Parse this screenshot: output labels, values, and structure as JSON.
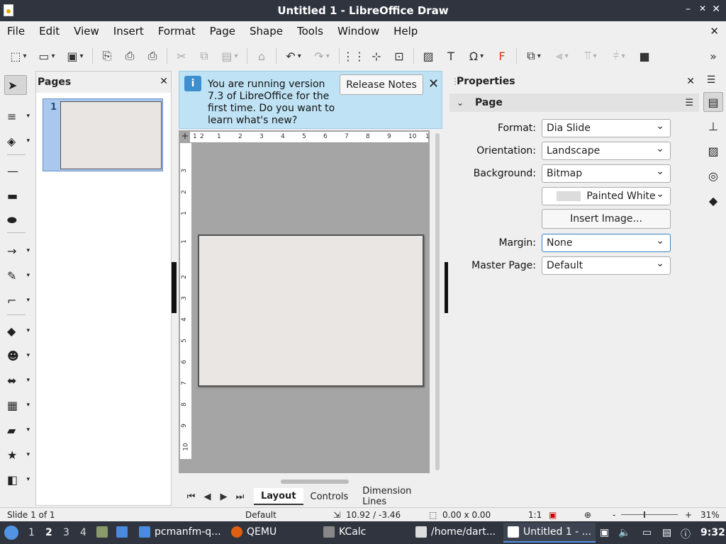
{
  "window": {
    "title": "Untitled 1 - LibreOffice Draw",
    "min": "–",
    "restore": "✕",
    "close": "✕"
  },
  "menu": [
    "File",
    "Edit",
    "View",
    "Insert",
    "Format",
    "Page",
    "Shape",
    "Tools",
    "Window",
    "Help"
  ],
  "menu_close": "✕",
  "pages_panel": {
    "title": "Pages",
    "close": "✕",
    "page_number": "1"
  },
  "infobar": {
    "message": "You are running version 7.3 of LibreOffice for the first time. Do you want to learn what's new?",
    "button": "Release Notes",
    "close": "✕",
    "icon_text": "i"
  },
  "rulers": {
    "h_ticks": [
      "1",
      "2",
      "1",
      "2",
      "3",
      "4",
      "5",
      "6",
      "7",
      "8",
      "9",
      "10",
      "1"
    ],
    "v_ticks": [
      "3",
      "2",
      "1",
      "1",
      "2",
      "3",
      "4",
      "5",
      "6",
      "7",
      "8",
      "9",
      "10"
    ],
    "corner": "+"
  },
  "tabs": {
    "layout": "Layout",
    "controls": "Controls",
    "dimension": "Dimension Lines"
  },
  "properties": {
    "title": "Properties",
    "close": "✕",
    "section": "Page",
    "format_label": "Format:",
    "format_value": "Dia Slide",
    "orientation_label": "Orientation:",
    "orientation_value": "Landscape",
    "background_label": "Background:",
    "background_value": "Bitmap",
    "bitmap_value": "Painted White",
    "insert_image": "Insert Image...",
    "margin_label": "Margin:",
    "margin_value": "None",
    "master_label": "Master Page:",
    "master_value": "Default"
  },
  "status": {
    "slide": "Slide 1 of 1",
    "layout": "Default",
    "position": "10.92 / -3.46",
    "size": "0.00 x 0.00",
    "scale": "1:1",
    "zoom_minus": "-",
    "zoom_plus": "+",
    "zoom": "31%",
    "zoom_level_percent": 31
  },
  "taskbar": {
    "workspaces": [
      "1",
      "2",
      "3",
      "4"
    ],
    "active_workspace": "2",
    "items": [
      "pcmanfm-q...",
      "QEMU",
      "KCalc",
      "/home/dart...",
      "Untitled 1 - ..."
    ],
    "time": "9:32"
  }
}
